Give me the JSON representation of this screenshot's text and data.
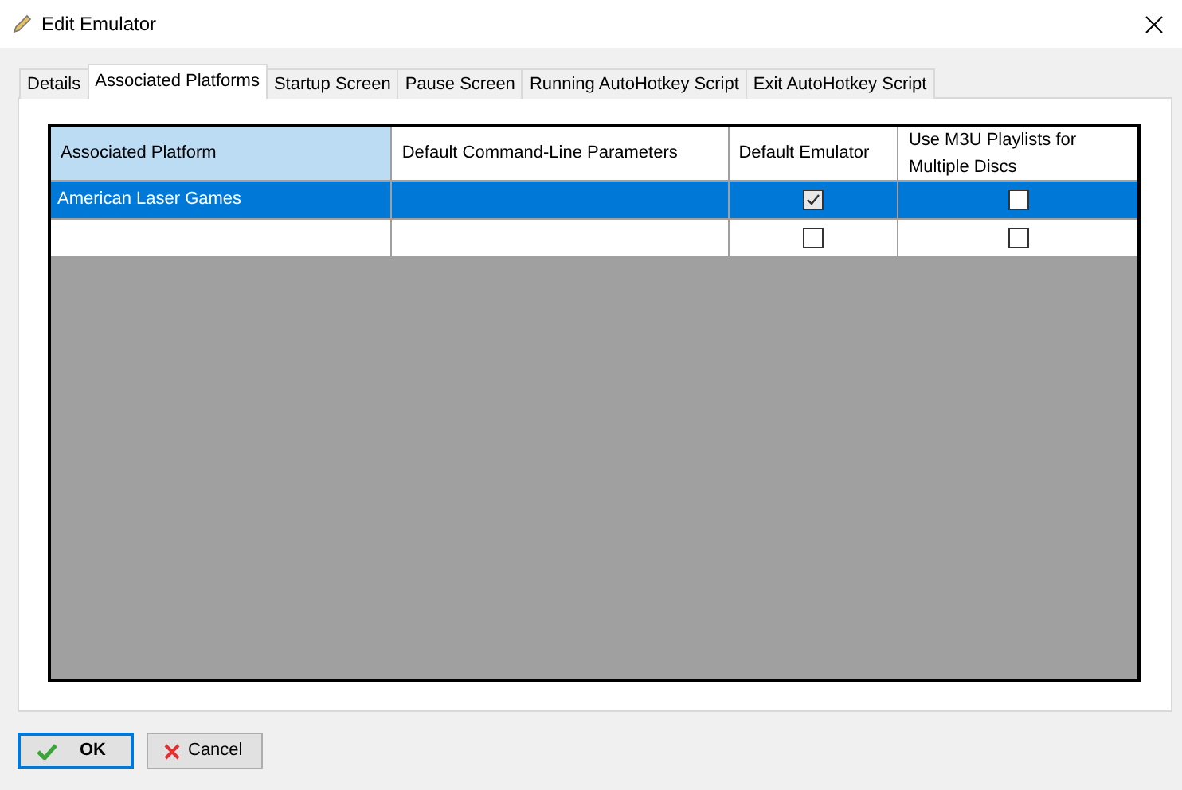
{
  "window": {
    "title": "Edit Emulator"
  },
  "tabs": [
    {
      "label": "Details",
      "selected": false
    },
    {
      "label": "Associated Platforms",
      "selected": true
    },
    {
      "label": "Startup Screen",
      "selected": false
    },
    {
      "label": "Pause Screen",
      "selected": false
    },
    {
      "label": "Running AutoHotkey Script",
      "selected": false
    },
    {
      "label": "Exit AutoHotkey Script",
      "selected": false
    }
  ],
  "table": {
    "columns": [
      {
        "label": "Associated Platform",
        "selected": true
      },
      {
        "label": "Default Command-Line Parameters",
        "selected": false
      },
      {
        "label": "Default Emulator",
        "selected": false
      },
      {
        "label": "Use M3U Playlists for Multiple Discs",
        "selected": false
      }
    ],
    "rows": [
      {
        "platform": "American Laser Games",
        "parameters": "",
        "default_emulator": true,
        "use_m3u": false,
        "selected": true
      },
      {
        "platform": "",
        "parameters": "",
        "default_emulator": false,
        "use_m3u": false,
        "selected": false
      }
    ]
  },
  "buttons": [
    {
      "kind": "ok",
      "label": "OK"
    },
    {
      "kind": "cancel",
      "label": "Cancel"
    }
  ]
}
